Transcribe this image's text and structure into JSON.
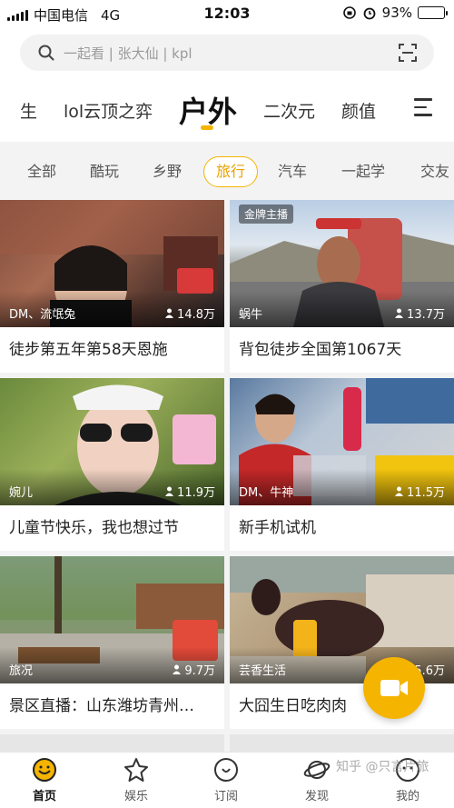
{
  "status_bar": {
    "carrier": "中国电信",
    "network": "4G",
    "time": "12:03",
    "battery": "93%",
    "battery_level": 0.93
  },
  "search": {
    "placeholder": "一起看 | 张大仙 | kpl"
  },
  "categories": [
    {
      "label": "生"
    },
    {
      "label": "lol云顶之弈"
    },
    {
      "label": "户外",
      "active": true
    },
    {
      "label": "二次元"
    },
    {
      "label": "颜值"
    }
  ],
  "filters": [
    {
      "label": "全部"
    },
    {
      "label": "酷玩"
    },
    {
      "label": "乡野"
    },
    {
      "label": "旅行",
      "active": true
    },
    {
      "label": "汽车"
    },
    {
      "label": "一起学"
    },
    {
      "label": "交友"
    }
  ],
  "cards": [
    {
      "title": "徒步第五年第58天恩施",
      "streamer": "DM、流氓兔",
      "viewers": "14.8万",
      "badge": ""
    },
    {
      "title": "背包徒步全国第1067天",
      "streamer": "蜗牛",
      "viewers": "13.7万",
      "badge": "金牌主播"
    },
    {
      "title": "儿童节快乐，我也想过节",
      "streamer": "婉儿",
      "viewers": "11.9万",
      "badge": ""
    },
    {
      "title": "新手机试机",
      "streamer": "DM、牛神",
      "viewers": "11.5万",
      "badge": ""
    },
    {
      "title": "景区直播：山东潍坊青州…",
      "streamer": "旅况",
      "viewers": "9.7万",
      "badge": ""
    },
    {
      "title": "大囧生日吃肉肉",
      "streamer": "芸香生活",
      "viewers": "5.6万",
      "badge": ""
    }
  ],
  "tabbar": [
    {
      "label": "首页",
      "icon": "home-icon",
      "active": true
    },
    {
      "label": "娱乐",
      "icon": "star-icon"
    },
    {
      "label": "订阅",
      "icon": "heart-icon"
    },
    {
      "label": "发现",
      "icon": "planet-icon"
    },
    {
      "label": "我的",
      "icon": "face-icon"
    }
  ],
  "watermark": "知乎 @只言片旅",
  "colors": {
    "accent": "#f5b400"
  }
}
